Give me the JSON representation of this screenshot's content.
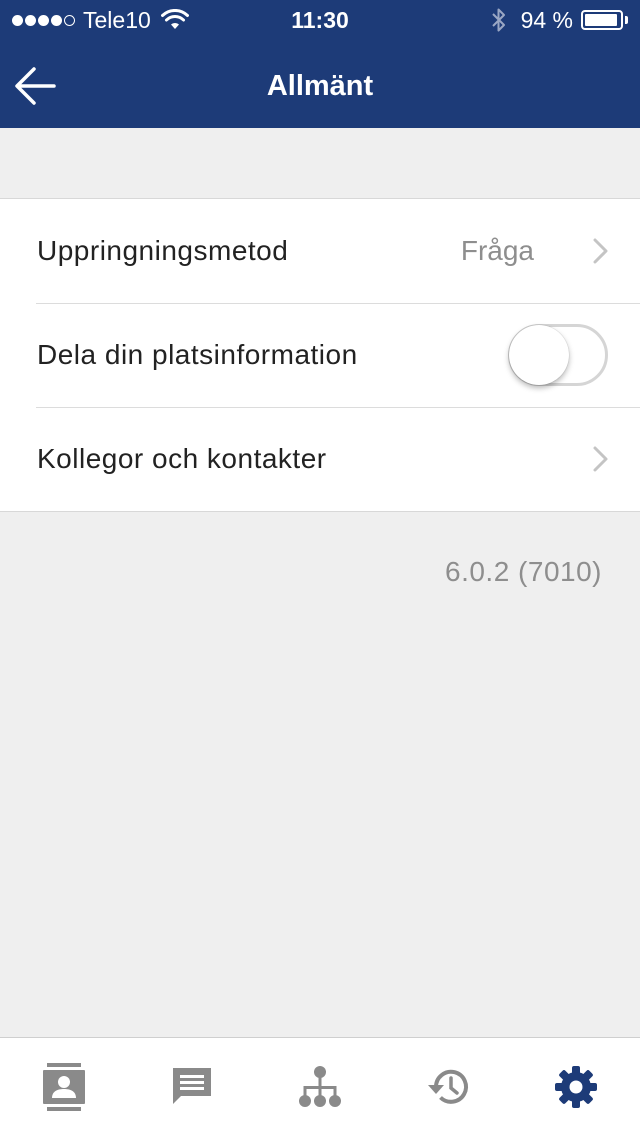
{
  "status_bar": {
    "carrier": "Tele10",
    "time": "11:30",
    "battery_percent": "94 %",
    "battery_level": 0.94,
    "signal_bars_filled": 4,
    "signal_bars_total": 5
  },
  "header": {
    "title": "Allmänt"
  },
  "settings": {
    "rows": [
      {
        "label": "Uppringningsmetod",
        "value": "Fråga"
      },
      {
        "label": "Dela din platsinformation",
        "toggle_on": false
      },
      {
        "label": "Kollegor och kontakter"
      }
    ]
  },
  "version": "6.0.2 (7010)",
  "tabs": [
    {
      "icon": "contacts-icon",
      "active": false
    },
    {
      "icon": "messages-icon",
      "active": false
    },
    {
      "icon": "organization-icon",
      "active": false
    },
    {
      "icon": "history-icon",
      "active": false
    },
    {
      "icon": "settings-gear-icon",
      "active": true
    }
  ],
  "colors": {
    "header_bg": "#1d3b78",
    "tab_inactive": "#8a8a8a",
    "tab_active": "#1d3b78",
    "background": "#efefef"
  }
}
